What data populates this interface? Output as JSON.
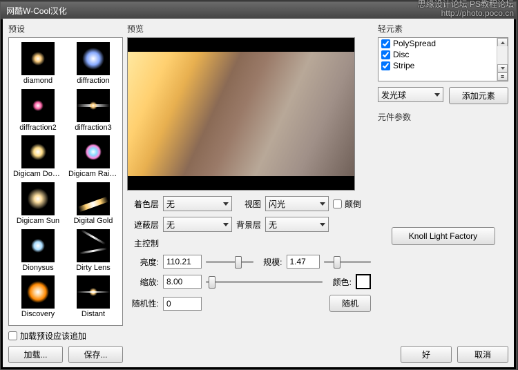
{
  "watermark": {
    "line1": "思缘设计论坛  PS教程论坛",
    "line2": "http://photo.poco.cn"
  },
  "window": {
    "title": "网酷W-Cool汉化"
  },
  "left": {
    "label": "预设",
    "presets": [
      "diamond",
      "diffraction",
      "diffraction2",
      "diffraction3",
      "Digicam Doubl...",
      "Digicam Rainbo...",
      "Digicam Sun",
      "Digital Gold",
      "Dionysus",
      "Dirty Lens",
      "Discovery",
      "Distant"
    ],
    "load_checkbox": "加载预设应该追加",
    "load_btn": "加载...",
    "save_btn": "保存..."
  },
  "mid": {
    "label": "预览",
    "color_layer_label": "着色层",
    "color_layer_value": "无",
    "view_label": "视图",
    "view_value": "闪光",
    "invert_label": "颠倒",
    "mask_layer_label": "遮蔽层",
    "mask_layer_value": "无",
    "bg_layer_label": "背景层",
    "bg_layer_value": "无",
    "main_ctrl_label": "主控制",
    "brightness_label": "亮度:",
    "brightness_value": "110.21",
    "scale_label": "规模:",
    "scale_value": "1.47",
    "zoom_label": "缩放:",
    "zoom_value": "8.00",
    "color_label": "颜色:",
    "random_label": "随机性:",
    "random_value": "0",
    "random_btn": "随机"
  },
  "right": {
    "label": "轻元素",
    "elements": [
      "PolySpread",
      "Disc",
      "Stripe"
    ],
    "glow_select": "发光球",
    "add_element_btn": "添加元素",
    "params_label": "元件参数",
    "knoll_btn": "Knoll Light Factory",
    "ok_btn": "好",
    "cancel_btn": "取消"
  }
}
